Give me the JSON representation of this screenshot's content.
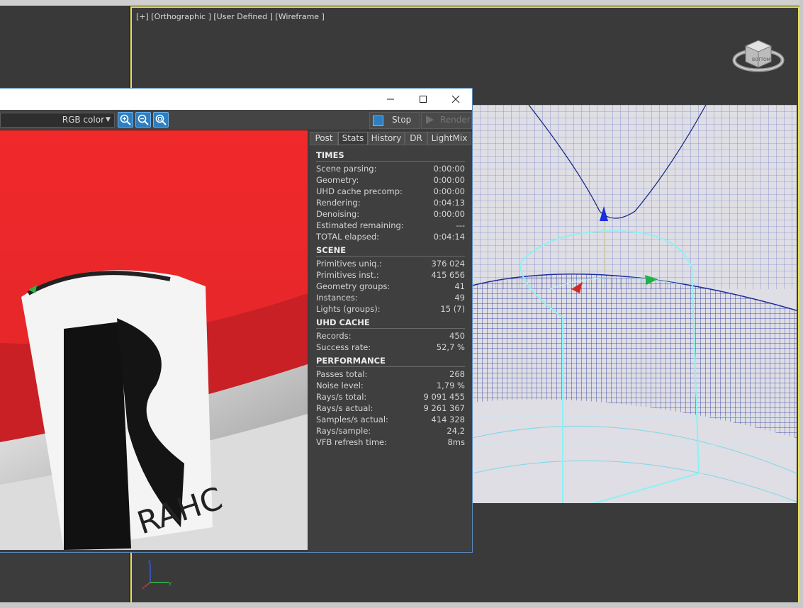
{
  "viewport": {
    "label": "[+] [Orthographic ] [User Defined ] [Wireframe ]",
    "viewcube_label": "BOTTOM"
  },
  "vfb": {
    "channel_label": "RGB color",
    "stop_label": "Stop",
    "render_label": "Render",
    "tabs": [
      "Post",
      "Stats",
      "History",
      "DR",
      "LightMix"
    ],
    "active_tab": "Stats",
    "sections": [
      {
        "title": "TIMES",
        "rows": [
          {
            "label": "Scene parsing:",
            "value": "0:00:00"
          },
          {
            "label": "Geometry:",
            "value": "0:00:00"
          },
          {
            "label": "UHD cache precomp:",
            "value": "0:00:00"
          },
          {
            "label": "Rendering:",
            "value": "0:04:13"
          },
          {
            "label": "Denoising:",
            "value": "0:00:00"
          },
          {
            "label": "Estimated remaining:",
            "value": "---"
          },
          {
            "label": "TOTAL elapsed:",
            "value": "0:04:14"
          }
        ]
      },
      {
        "title": "SCENE",
        "rows": [
          {
            "label": "Primitives uniq.:",
            "value": "376 024"
          },
          {
            "label": "Primitives inst.:",
            "value": "415 656"
          },
          {
            "label": "Geometry groups:",
            "value": "41"
          },
          {
            "label": "Instances:",
            "value": "49"
          },
          {
            "label": "Lights (groups):",
            "value": "15 (7)"
          }
        ]
      },
      {
        "title": "UHD CACHE",
        "rows": [
          {
            "label": "Records:",
            "value": "450"
          },
          {
            "label": "Success rate:",
            "value": "52,7 %"
          }
        ]
      },
      {
        "title": "PERFORMANCE",
        "rows": [
          {
            "label": "Passes total:",
            "value": "268"
          },
          {
            "label": "Noise level:",
            "value": "1,79 %"
          },
          {
            "label": "Rays/s total:",
            "value": "9 091 455"
          },
          {
            "label": "Rays/s actual:",
            "value": "9 261 367"
          },
          {
            "label": "Samples/s actual:",
            "value": "414 328"
          },
          {
            "label": "Rays/sample:",
            "value": "24,2"
          },
          {
            "label": "VFB refresh time:",
            "value": "8ms"
          }
        ]
      }
    ]
  },
  "colors": {
    "active_viewport_border": "#e6df5a",
    "accent_blue": "#2d7fc1",
    "render_red": "#e8262a"
  }
}
